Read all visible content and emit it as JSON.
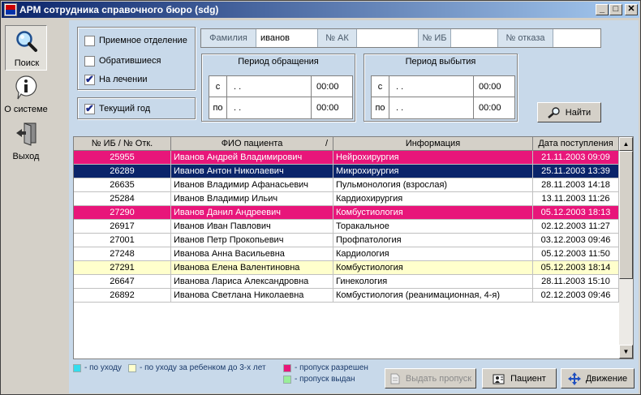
{
  "window": {
    "title": "АРМ сотрудника справочного бюро (sdg)",
    "min_glyph": "_",
    "max_glyph": "□",
    "close_glyph": "✕"
  },
  "nav": [
    {
      "label": "Поиск",
      "icon": "magnifier-icon",
      "active": true
    },
    {
      "label": "О системе",
      "icon": "info-icon",
      "active": false
    },
    {
      "label": "Выход",
      "icon": "exit-door-icon",
      "active": false
    }
  ],
  "filters": {
    "checkboxes": [
      {
        "label": "Приемное отделение",
        "checked": false
      },
      {
        "label": "Обратившиеся",
        "checked": false
      },
      {
        "label": "На лечении",
        "checked": true
      }
    ],
    "current_year": {
      "label": "Текущий год",
      "checked": true
    }
  },
  "search": {
    "surname_label": "Фамилия",
    "surname_value": "иванов",
    "ak_label": "№ АК",
    "ak_value": "",
    "ib_label": "№ ИБ",
    "ib_value": "",
    "refusal_label": "№ отказа",
    "refusal_value": ""
  },
  "period_visit": {
    "title": "Период обращения",
    "from_label": "с",
    "to_label": "по",
    "from_date": " .  .",
    "from_time": "00:00",
    "to_date": " .  .",
    "to_time": "00:00"
  },
  "period_discharge": {
    "title": "Период выбытия",
    "from_label": "с",
    "to_label": "по",
    "from_date": " .  .",
    "from_time": "00:00",
    "to_date": " .  .",
    "to_time": "00:00"
  },
  "find_button": "Найти",
  "table": {
    "columns": [
      "№ ИБ / № Отк.",
      "ФИО пациента",
      "Информация",
      "Дата поступления"
    ],
    "sort_marker": "/",
    "rows": [
      {
        "id": "25955",
        "name": "Иванов Андрей Владимирович",
        "info": "Нейрохирургия",
        "date": "21.11.2003 09:09",
        "bg": "#e8167a",
        "fg": "#ffffff"
      },
      {
        "id": "26289",
        "name": "Иванов Антон Николаевич",
        "info": "Микрохирургия",
        "date": "25.11.2003 13:39",
        "bg": "#0a246a",
        "fg": "#ffffff"
      },
      {
        "id": "26635",
        "name": "Иванов Владимир Афанасьевич",
        "info": "Пульмонология (взрослая)",
        "date": "28.11.2003 14:18",
        "bg": "#ffffff",
        "fg": "#000000"
      },
      {
        "id": "25284",
        "name": "Иванов Владимир Ильич",
        "info": "Кардиохирургия",
        "date": "13.11.2003 11:26",
        "bg": "#ffffff",
        "fg": "#000000"
      },
      {
        "id": "27290",
        "name": "Иванов Данил Андреевич",
        "info": "Комбустиология",
        "date": "05.12.2003 18:13",
        "bg": "#e8167a",
        "fg": "#ffffff"
      },
      {
        "id": "26917",
        "name": "Иванов Иван Павлович",
        "info": "Торакальное",
        "date": "02.12.2003 11:27",
        "bg": "#ffffff",
        "fg": "#000000"
      },
      {
        "id": "27001",
        "name": "Иванов Петр Прокопьевич",
        "info": "Профпатология",
        "date": "03.12.2003 09:46",
        "bg": "#ffffff",
        "fg": "#000000"
      },
      {
        "id": "27248",
        "name": "Иванова Анна Васильевна",
        "info": "Кардиология",
        "date": "05.12.2003 11:50",
        "bg": "#ffffff",
        "fg": "#000000"
      },
      {
        "id": "27291",
        "name": "Иванова Елена Валентиновна",
        "info": "Комбустиология",
        "date": "05.12.2003 18:14",
        "bg": "#ffffcc",
        "fg": "#000000"
      },
      {
        "id": "26647",
        "name": "Иванова Лариса Александровна",
        "info": "Гинекология",
        "date": "28.11.2003 15:10",
        "bg": "#ffffff",
        "fg": "#000000"
      },
      {
        "id": "26892",
        "name": "Иванова Светлана Николаевна",
        "info": "Комбустиология (реанимационная, 4-я)",
        "date": "02.12.2003 09:46",
        "bg": "#ffffff",
        "fg": "#000000"
      }
    ]
  },
  "legend": [
    {
      "text": "- по уходу",
      "color": "#33ddee"
    },
    {
      "text": "- по уходу за ребенком до 3-х лет",
      "color": "#ffffcc"
    },
    {
      "text": "- пропуск разрешен",
      "color": "#e8167a"
    },
    {
      "text": "- пропуск выдан",
      "color": "#99ee99"
    }
  ],
  "actions": {
    "pass_button": "Выдать пропуск",
    "patient_button": "Пациент",
    "move_button": "Движение"
  }
}
